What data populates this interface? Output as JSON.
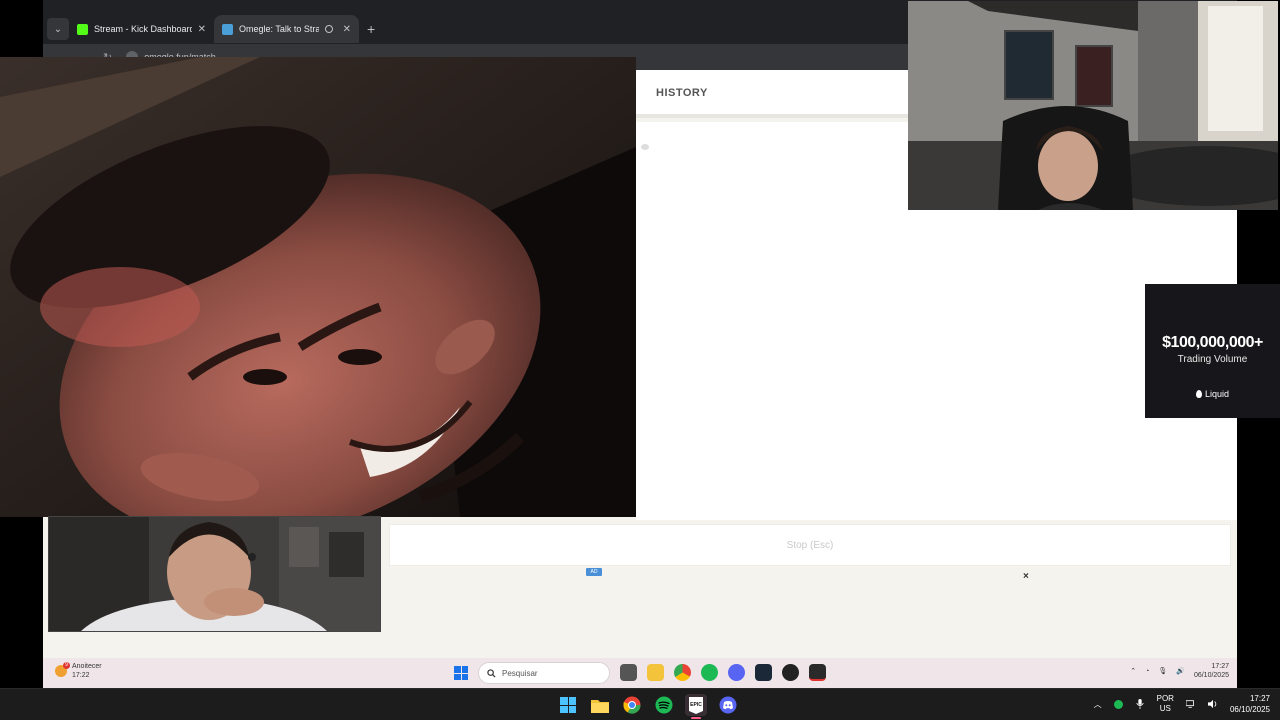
{
  "browser": {
    "tabs": [
      {
        "title": "Stream - Kick Dashboard",
        "favicon_color": "#53fc18",
        "active": false
      },
      {
        "title": "Omegle: Talk to Strangers",
        "favicon_color": "#4a9fd9",
        "active": true
      }
    ],
    "new_tab_icon": "plus-icon",
    "url": "omegle.fun/match"
  },
  "omegle": {
    "history_label": "HISTORY",
    "stop_label": "Stop (Esc)",
    "ad_label": "AD",
    "ad_close": "×"
  },
  "inner_taskbar": {
    "weather_badge": "9",
    "weather_title": "Anoitecer",
    "weather_time": "17:22",
    "search_placeholder": "Pesquisar",
    "clock_time": "17:27",
    "clock_date": "06/10/2025"
  },
  "sponsor": {
    "amount": "$100,000,000+",
    "subtitle": "Trading Volume",
    "brand": "Liquid"
  },
  "taskbar": {
    "lang_top": "POR",
    "lang_bottom": "US",
    "time": "17:27",
    "date": "06/10/2025"
  },
  "colors": {
    "accent": "#ff5c8a",
    "windows_blue": "#4cc2ff",
    "spotify": "#1db954",
    "discord": "#5865f2"
  }
}
